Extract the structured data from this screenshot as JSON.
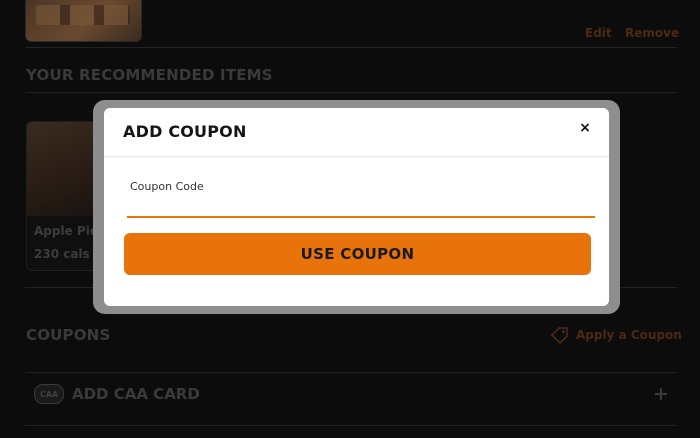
{
  "background": {
    "cart_item": {
      "edit_label": "Edit",
      "remove_label": "Remove"
    },
    "recommended": {
      "title": "YOUR RECOMMENDED ITEMS",
      "items": [
        {
          "name": "Apple Pie",
          "calories": "230 cals"
        }
      ]
    },
    "coupons": {
      "title": "COUPONS",
      "apply_label": "Apply a Coupon",
      "icon": "tag-icon"
    },
    "caa": {
      "logo_text": "CAA",
      "label": "ADD CAA CARD",
      "expand_symbol": "+"
    }
  },
  "modal": {
    "title": "ADD COUPON",
    "close_symbol": "×",
    "field_label": "Coupon Code",
    "field_value": "",
    "field_placeholder": "",
    "submit_label": "USE COUPON"
  },
  "colors": {
    "accent": "#e8730a",
    "background": "#0c0c0c",
    "modal_frame": "#8e8e8e",
    "modal_bg": "#ffffff"
  }
}
